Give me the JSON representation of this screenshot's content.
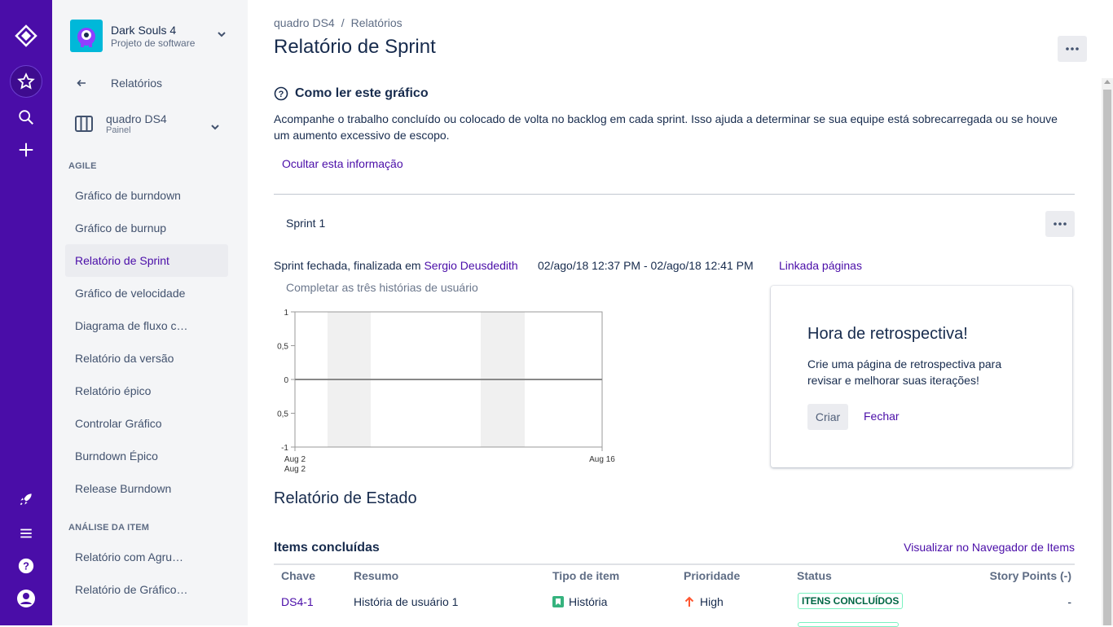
{
  "global_nav": {
    "icons": [
      "jira-logo-icon",
      "star-icon",
      "search-icon",
      "plus-icon",
      "rocket-icon",
      "menu-icon",
      "help-icon",
      "user-icon"
    ]
  },
  "sidebar": {
    "project_name": "Dark Souls 4",
    "project_type": "Projeto de software",
    "back_label": "Relatórios",
    "board_name": "quadro DS4",
    "board_sub": "Painel",
    "section_agile": "AGILE",
    "agile_items": [
      {
        "label": "Gráfico de burndown"
      },
      {
        "label": "Gráfico de burnup"
      },
      {
        "label": "Relatório de Sprint"
      },
      {
        "label": "Gráfico de velocidade"
      },
      {
        "label": "Diagrama de fluxo c…"
      },
      {
        "label": "Relatório da versão"
      },
      {
        "label": "Relatório épico"
      },
      {
        "label": "Controlar Gráfico"
      },
      {
        "label": "Burndown Épico"
      },
      {
        "label": "Release Burndown"
      }
    ],
    "section_analysis": "ANÁLISE DA ITEM",
    "analysis_items": [
      {
        "label": "Relatório com Agru…"
      },
      {
        "label": "Relatório de Gráfico…"
      }
    ],
    "selected_item": "Relatório de Sprint"
  },
  "breadcrumbs": {
    "board": "quadro DS4",
    "separator": "/",
    "reports": "Relatórios"
  },
  "page": {
    "title": "Relatório de Sprint",
    "how_to_heading": "Como ler este gráfico",
    "description": "Acompanhe o trabalho concluído ou colocado de volta no backlog em cada sprint. Isso ajuda a determinar se sua equipe está sobrecarregada ou se houve um aumento excessivo de escopo.",
    "hide_info": "Ocultar esta informação"
  },
  "sprint": {
    "selected": "Sprint 1",
    "status_prefix": "Sprint fechada, finalizada em",
    "user": "Sergio Deusdedith",
    "dates": "02/ago/18 12:37 PM - 02/ago/18 12:41 PM",
    "linked_pages": "Linkada páginas",
    "goal": "Completar as três histórias de usuário"
  },
  "chart_data": {
    "type": "line",
    "x_ticks": [
      "Aug 2",
      "Aug 16"
    ],
    "x_sublabel": "Aug 2",
    "y_ticks": [
      "1",
      "0,5",
      "0",
      "0,5",
      "-1"
    ],
    "ylim": [
      -1,
      1
    ],
    "series": [
      {
        "values": [
          0,
          0
        ]
      }
    ]
  },
  "retro": {
    "title": "Hora de retrospectiva!",
    "body": "Crie uma página de retrospectiva para revisar e melhorar suas iterações!",
    "create": "Criar",
    "close": "Fechar"
  },
  "status_report": {
    "heading": "Relatório de Estado",
    "completed_heading": "Items concluídas",
    "navigator_link": "Visualizar no Navegador de Items",
    "columns": [
      "Chave",
      "Resumo",
      "Tipo de item",
      "Prioridade",
      "Status",
      "Story Points (-)"
    ],
    "rows": [
      {
        "key": "DS4-1",
        "summary": "História de usuário 1",
        "type": "História",
        "priority": "High",
        "status": "ITENS CONCLUÍDOS",
        "points": "-"
      }
    ]
  },
  "colors": {
    "nav_bg": "#4A0DA8",
    "link": "#4A0DA8",
    "done_green": "#006644",
    "priority_high": "#FF5630",
    "story_green": "#36B37E"
  }
}
